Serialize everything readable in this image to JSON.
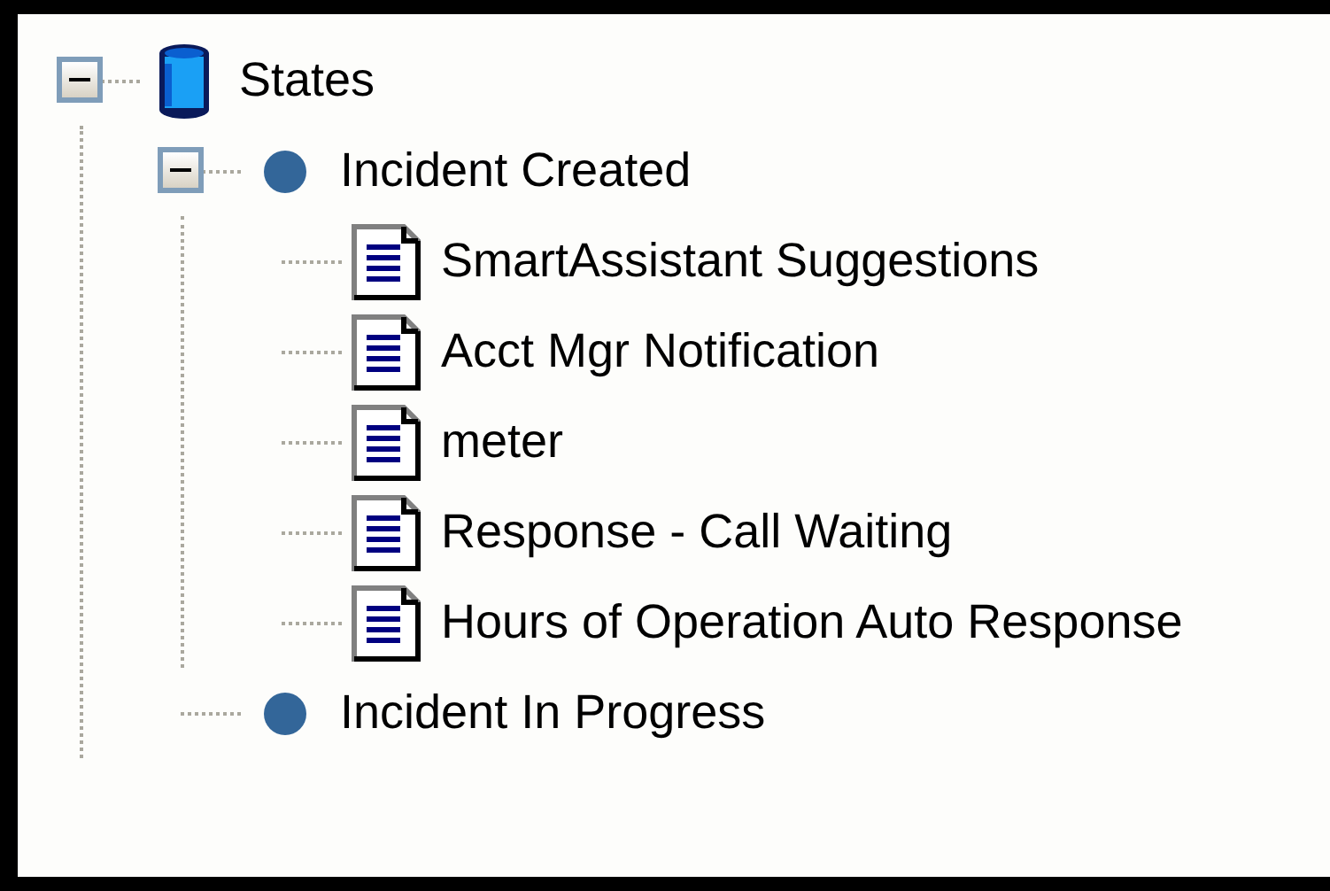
{
  "tree": [
    {
      "label": "States",
      "kind": "root",
      "expanded": true,
      "children": [
        {
          "label": "Incident Created",
          "kind": "state",
          "expanded": true,
          "children": [
            {
              "label": "SmartAssistant Suggestions",
              "kind": "document"
            },
            {
              "label": "Acct Mgr Notification",
              "kind": "document"
            },
            {
              "label": "meter",
              "kind": "document"
            },
            {
              "label": "Response - Call Waiting",
              "kind": "document"
            },
            {
              "label": "Hours of Operation Auto Response",
              "kind": "document"
            }
          ]
        },
        {
          "label": "Incident In Progress",
          "kind": "state"
        }
      ]
    }
  ]
}
